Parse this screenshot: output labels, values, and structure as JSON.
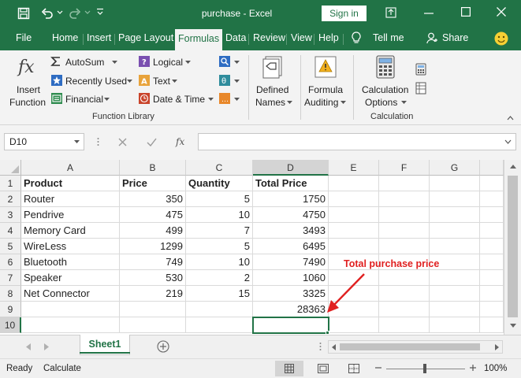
{
  "window": {
    "title": "purchase  -  Excel",
    "signin_label": "Sign in"
  },
  "tabs": [
    "File",
    "Home",
    "Insert",
    "Page Layout",
    "Formulas",
    "Data",
    "Review",
    "View",
    "Help"
  ],
  "tell_me": "Tell me",
  "share": "Share",
  "ribbon": {
    "insert_function": [
      "Insert",
      "Function"
    ],
    "autosum": "AutoSum",
    "recently_used": "Recently Used",
    "financial": "Financial",
    "logical": "Logical",
    "text": "Text",
    "date_time": "Date & Time",
    "defined_names": [
      "Defined",
      "Names"
    ],
    "formula_auditing": [
      "Formula",
      "Auditing"
    ],
    "calculation_options": [
      "Calculation",
      "Options"
    ],
    "group_function_library": "Function Library",
    "group_calculation": "Calculation"
  },
  "formula_bar": {
    "name_box": "D10",
    "fx": "fx",
    "formula": ""
  },
  "columns": [
    "A",
    "B",
    "C",
    "D",
    "E",
    "F",
    "G"
  ],
  "rows": [
    "1",
    "2",
    "3",
    "4",
    "5",
    "6",
    "7",
    "8",
    "9",
    "10"
  ],
  "table": {
    "headers": [
      "Product",
      "Price",
      "Quantity",
      "Total Price"
    ],
    "rows": [
      [
        "Router",
        "350",
        "5",
        "1750"
      ],
      [
        "Pendrive",
        "475",
        "10",
        "4750"
      ],
      [
        "Memory Card",
        "499",
        "7",
        "3493"
      ],
      [
        "WireLess",
        "1299",
        "5",
        "6495"
      ],
      [
        "Bluetooth",
        "749",
        "10",
        "7490"
      ],
      [
        "Speaker",
        "530",
        "2",
        "1060"
      ],
      [
        "Net Connector",
        "219",
        "15",
        "3325"
      ]
    ],
    "total": "28363"
  },
  "annotation": "Total purchase price",
  "sheet_tab": "Sheet1",
  "status": {
    "ready": "Ready",
    "calculate": "Calculate",
    "zoom": "100%"
  },
  "colors": {
    "excel_green": "#217346",
    "annotation_red": "#e02020"
  }
}
